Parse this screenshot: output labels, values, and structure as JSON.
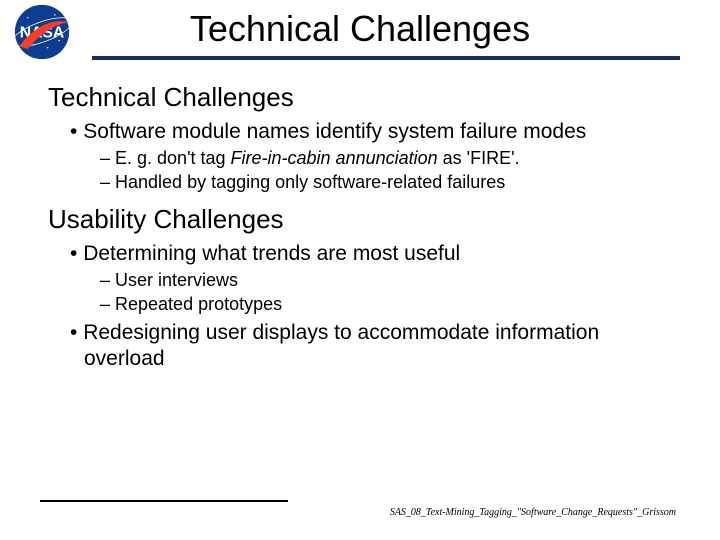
{
  "header": {
    "title": "Technical Challenges",
    "logo_alt": "NASA"
  },
  "sections": [
    {
      "heading": "Technical Challenges",
      "bullets": [
        {
          "text": "Software module names identify system failure modes",
          "sub": [
            {
              "pre": "E. g. don't tag ",
              "em": "Fire-in-cabin annunciation",
              "post": " as 'FIRE'."
            },
            {
              "pre": "Handled by tagging only software-related failures",
              "em": "",
              "post": ""
            }
          ]
        }
      ]
    },
    {
      "heading": "Usability Challenges",
      "bullets": [
        {
          "text": "Determining what trends are most useful",
          "sub": [
            {
              "pre": "User interviews",
              "em": "",
              "post": ""
            },
            {
              "pre": "Repeated prototypes",
              "em": "",
              "post": ""
            }
          ]
        },
        {
          "text": "Redesigning user displays to accommodate information overload",
          "sub": []
        }
      ]
    }
  ],
  "footer": {
    "text": "SAS_08_Text-Mining_Tagging_\"Software_Change_Requests\"_Grissom"
  }
}
